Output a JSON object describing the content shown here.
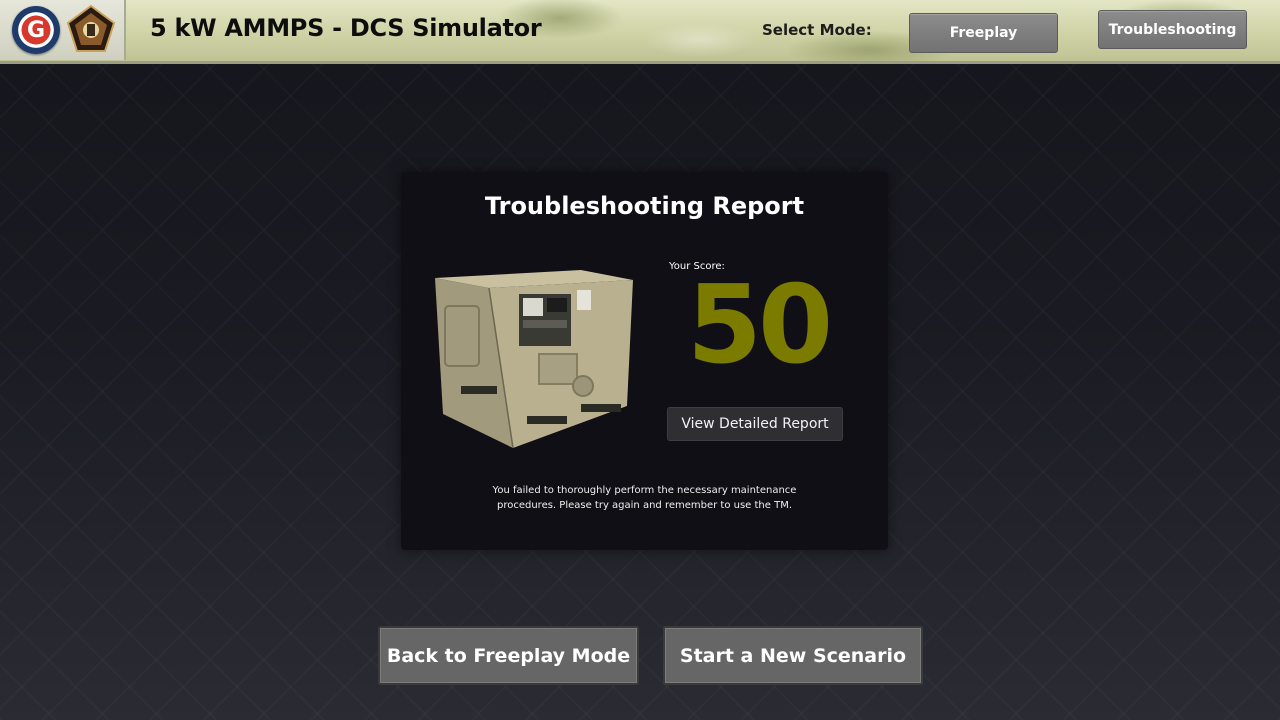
{
  "header": {
    "title": "5 kW AMMPS - DCS Simulator",
    "select_mode_label": "Select Mode:",
    "modes": [
      {
        "label": "Freeplay"
      },
      {
        "label": "Troubleshooting"
      }
    ],
    "logos": [
      "g-emblem-logo",
      "pentagon-crest-logo"
    ]
  },
  "report": {
    "title": "Troubleshooting Report",
    "image": "generator-image",
    "score_label": "Your Score:",
    "score": "50",
    "score_color": "#7b7b00",
    "detail_button_label": "View Detailed Report",
    "feedback_line1": "You failed to thoroughly perform the necessary maintenance",
    "feedback_line2": "procedures. Please try again and remember to use the TM."
  },
  "actions": {
    "back_label": "Back to Freeplay Mode",
    "new_label": "Start a New Scenario"
  }
}
